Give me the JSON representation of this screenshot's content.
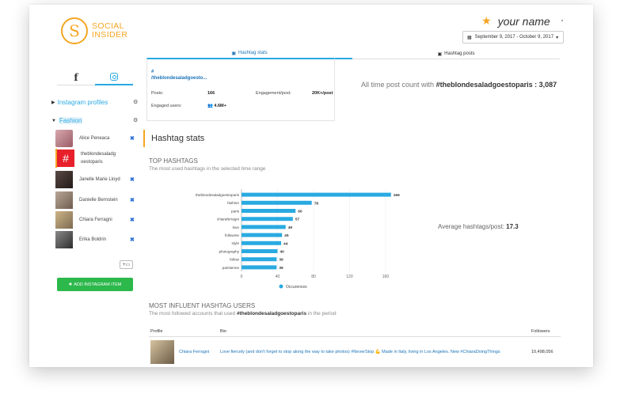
{
  "header": {
    "logo_letter": "S",
    "logo_line1": "SOCIAL",
    "logo_line2": "INSIDER",
    "username": "your name",
    "date_range": "September 9, 2017 - October 9, 2017"
  },
  "tabs": {
    "hashtag_stats": "Hashtag stats",
    "hashtag_posts": "Hashtag posts"
  },
  "sidebar": {
    "instagram_profiles": "Instagram profiles",
    "fashion": "Fashion",
    "profiles": [
      {
        "name": "Alice Peneaca"
      },
      {
        "name": "theblondesaladg oestoparis"
      },
      {
        "name": "Janelle Marie Lloyd"
      },
      {
        "name": "Danielle Bernstein"
      },
      {
        "name": "Chiara Ferragni"
      },
      {
        "name": "Erika Boldrin"
      }
    ],
    "add_button": "ADD INSTAGRAM ITEM"
  },
  "stats_box": {
    "hash_line1": "#",
    "hash_line2": "/theblondesaladgoesto...",
    "posts_label": "Posts:",
    "posts_value": "166",
    "engagement_label": "Engagement/post:",
    "engagement_value": "20K+/post",
    "engaged_label": "Engaged users:",
    "engaged_value": "4.6M+"
  },
  "alltime": {
    "prefix": "All time post count with",
    "hashtag": "#theblondesaladgoestoparis",
    "value": ": 3,087"
  },
  "section": {
    "title": "Hashtag stats",
    "top_heading": "TOP HASHTAGS",
    "top_sub": "The most used hashtags in the selected time range",
    "avg_label": "Average hashtags/post:",
    "avg_value": "17.3",
    "most_heading": "MOST INFLUENT HASHTAG USERS",
    "most_sub_prefix": "The most followed accounts that used",
    "most_sub_tag": "#theblondesaladgoestoparis",
    "most_sub_suffix": "in the period"
  },
  "table": {
    "col_profile": "Profile",
    "col_bio": "Bio",
    "col_followers": "Followers",
    "rows": [
      {
        "profile": "Chiara Ferragni",
        "bio": "Love fiercely (and don't forget to stop along the way to take photos) #NeverStop 💪 Made in Italy, living in Los Angeles. New #ChiaraDoingThings",
        "followers": "10,498,056"
      }
    ]
  },
  "chart_data": {
    "type": "bar",
    "orientation": "horizontal",
    "categories": [
      "theblondesaladgoestoparis",
      "fashion",
      "paris",
      "chiaraferragni",
      "love",
      "followme",
      "style",
      "photography",
      "follow",
      "parisienne"
    ],
    "values": [
      166,
      78,
      60,
      57,
      49,
      45,
      44,
      40,
      39,
      39
    ],
    "series": [
      {
        "name": "Occurences",
        "values": [
          166,
          78,
          60,
          57,
          49,
          45,
          44,
          40,
          39,
          39
        ]
      }
    ],
    "xticks": [
      0,
      40,
      80,
      120,
      160
    ],
    "xlim": [
      0,
      175
    ],
    "bar_color": "#29aae1",
    "legend": "bottom"
  }
}
